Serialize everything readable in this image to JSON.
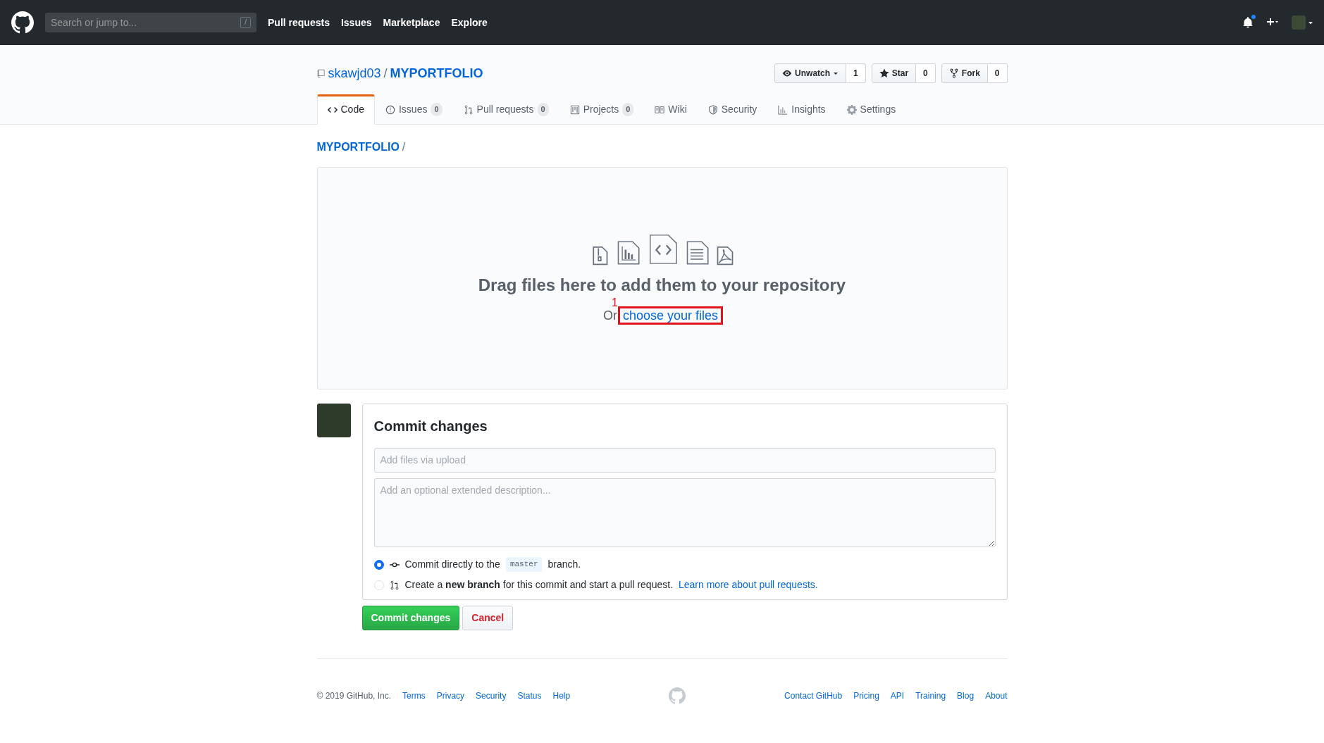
{
  "header": {
    "search_placeholder": "Search or jump to...",
    "search_key": "/",
    "nav": [
      "Pull requests",
      "Issues",
      "Marketplace",
      "Explore"
    ],
    "notification_unread": true
  },
  "repo": {
    "owner": "skawjd03",
    "separator": "/",
    "name": "MYPORTFOLIO",
    "actions": [
      {
        "kind": "watch",
        "label": "Unwatch",
        "count": "1"
      },
      {
        "kind": "star",
        "label": "Star",
        "count": "0"
      },
      {
        "kind": "fork",
        "label": "Fork",
        "count": "0"
      }
    ],
    "tabs": [
      {
        "kind": "code",
        "label": "Code",
        "selected": true
      },
      {
        "kind": "issues",
        "label": "Issues",
        "count": "0",
        "selected": false
      },
      {
        "kind": "pulls",
        "label": "Pull requests",
        "count": "0",
        "selected": false
      },
      {
        "kind": "projects",
        "label": "Projects",
        "count": "0",
        "selected": false
      },
      {
        "kind": "wiki",
        "label": "Wiki",
        "selected": false
      },
      {
        "kind": "security",
        "label": "Security",
        "selected": false
      },
      {
        "kind": "insights",
        "label": "Insights",
        "selected": false
      },
      {
        "kind": "settings",
        "label": "Settings",
        "selected": false
      }
    ]
  },
  "breadcrumb": {
    "repo": "MYPORTFOLIO",
    "separator": "/"
  },
  "dropzone": {
    "title": "Drag files here to add them to your repository",
    "prefix": "Or",
    "link": "choose your files",
    "annotation": "1"
  },
  "commit": {
    "title": "Commit changes",
    "summary_placeholder": "Add files via upload",
    "description_placeholder": "Add an optional extended description...",
    "options": [
      {
        "kind": "direct",
        "selected": true,
        "before": "Commit directly to the",
        "branch": "master",
        "after": "branch."
      },
      {
        "kind": "new_branch",
        "selected": false,
        "text": "Create a **new branch** for this commit and start a pull request.",
        "link": "Learn more about pull requests."
      }
    ],
    "buttons": [
      {
        "kind": "primary",
        "label": "Commit changes"
      },
      {
        "kind": "cancel",
        "label": "Cancel"
      }
    ]
  },
  "footer": {
    "copyright": "© 2019 GitHub, Inc.",
    "left_links": [
      "Terms",
      "Privacy",
      "Security",
      "Status",
      "Help"
    ],
    "right_links": [
      "Contact GitHub",
      "Pricing",
      "API",
      "Training",
      "Blog",
      "About"
    ]
  }
}
